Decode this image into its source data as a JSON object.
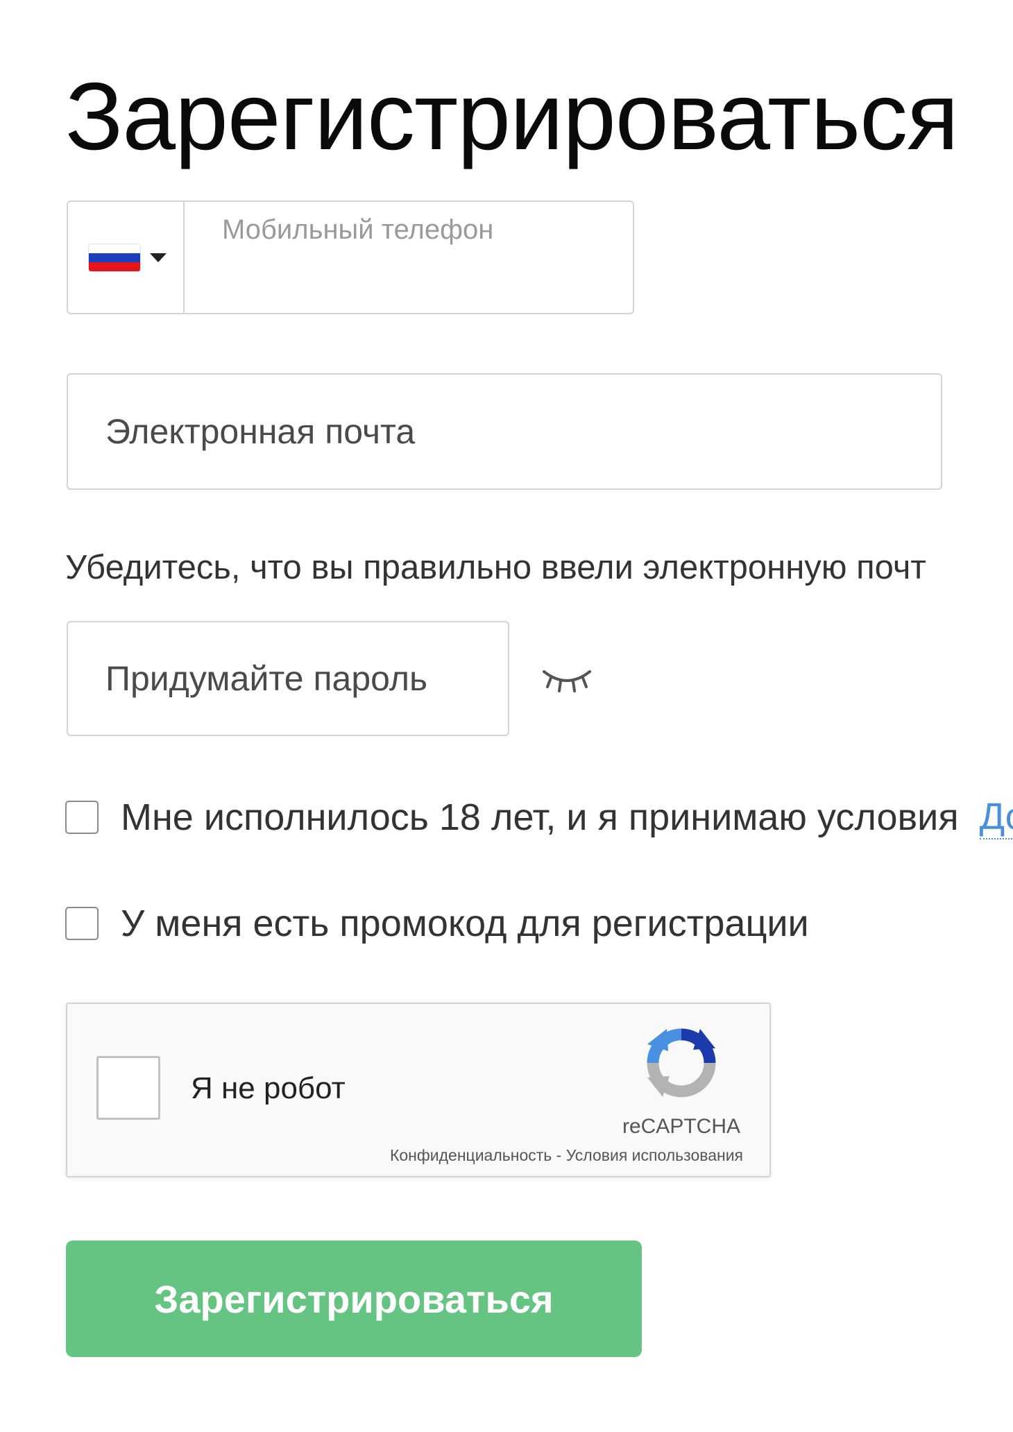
{
  "form": {
    "title": "Зарегистрироваться",
    "phone": {
      "label": "Мобильный телефон",
      "value": "",
      "country_flag": [
        "#ffffff",
        "#1c3fbf",
        "#e4161b"
      ]
    },
    "email": {
      "placeholder": "Электронная почта",
      "hint": "Убедитесь, что вы правильно ввели электронную почт"
    },
    "password": {
      "placeholder": "Придумайте пароль",
      "toggle_icon": "eye-closed-icon"
    },
    "age_checkbox": {
      "label": "Мне исполнилось 18 лет, и я принимаю условия",
      "link_text": "До"
    },
    "promo_checkbox": {
      "label": "У меня есть промокод для регистрации"
    },
    "recaptcha": {
      "label": "Я не робот",
      "brand": "reCAPTCHA",
      "privacy_link": "Конфиденциальность",
      "separator": " - ",
      "terms_link": "Условия использования"
    },
    "submit_label": "Зарегистрироваться"
  },
  "colors": {
    "submit_bg": "#66c483",
    "link": "#4a90d9"
  }
}
